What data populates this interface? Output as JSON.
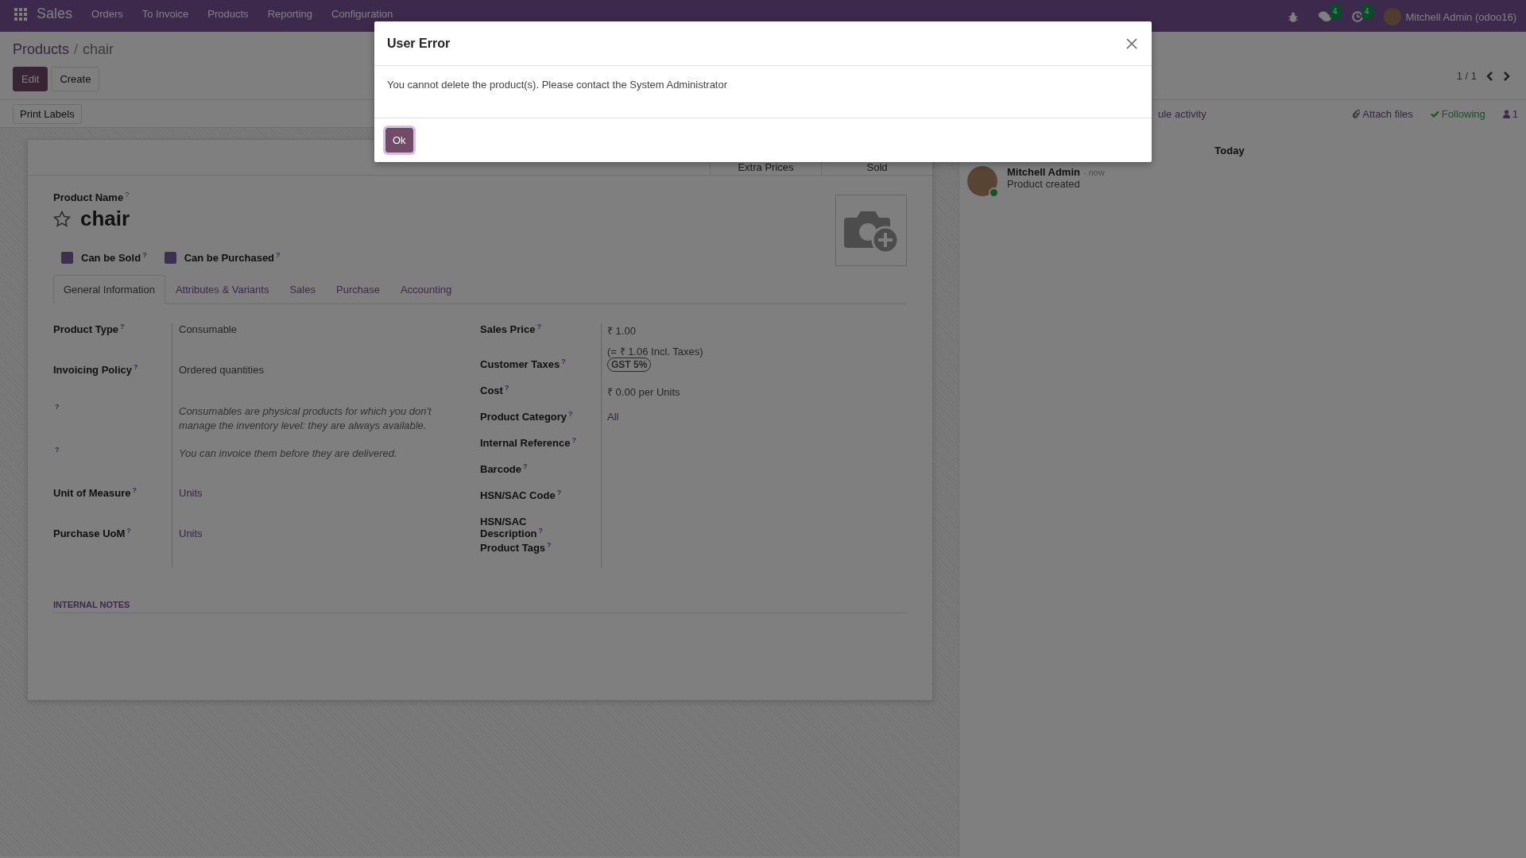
{
  "navbar": {
    "app": "Sales",
    "menu": [
      "Orders",
      "To Invoice",
      "Products",
      "Reporting",
      "Configuration"
    ],
    "messages_badge": "4",
    "activities_badge": "4",
    "user": "Mitchell Admin (odoo16)"
  },
  "breadcrumb": {
    "parent": "Products",
    "separator": "/",
    "current": "chair"
  },
  "buttons": [
    {
      "label": "Edit",
      "kind": "primary"
    },
    {
      "label": "Create",
      "kind": "secondary"
    }
  ],
  "pager": "1 / 1",
  "status_actions": [
    "Print Labels"
  ],
  "smart_buttons": [
    "Extra Prices",
    "Sold"
  ],
  "product": {
    "name_label": "Product Name",
    "name_help": "?",
    "name": "chair",
    "favorite": false,
    "options": [
      {
        "label": "Can be Sold",
        "help": "?",
        "checked": true
      },
      {
        "label": "Can be Purchased",
        "help": "?",
        "checked": true
      }
    ]
  },
  "tabs": [
    {
      "label": "General Information",
      "selected": true
    },
    {
      "label": "Attributes & Variants",
      "selected": false
    },
    {
      "label": "Sales",
      "selected": false
    },
    {
      "label": "Purchase",
      "selected": false
    },
    {
      "label": "Accounting",
      "selected": false
    }
  ],
  "fields_left": [
    {
      "label": "Product Type",
      "help": "?",
      "value": "Consumable",
      "kind": "text"
    },
    {
      "label": "Invoicing Policy",
      "help": "?",
      "value": "Ordered quantities",
      "kind": "text"
    },
    {
      "help": "?",
      "value": "Consumables are physical products for which you don't manage the inventory level: they are always available.",
      "kind": "note"
    },
    {
      "help": "?",
      "value": "You can invoice them before they are delivered.",
      "kind": "note"
    },
    {
      "label": "Unit of Measure",
      "help": "?",
      "value": "Units",
      "kind": "link"
    },
    {
      "label": "Purchase UoM",
      "help": "?",
      "value": "Units",
      "kind": "link"
    }
  ],
  "fields_right": [
    {
      "label": "Sales Price",
      "help": "?",
      "value": "₹ 1.00",
      "extra": "(= ₹ 1.06 Incl. Taxes)",
      "kind": "text"
    },
    {
      "label": "Customer Taxes",
      "help": "?",
      "value": "GST 5%",
      "kind": "tag"
    },
    {
      "label": "Cost",
      "help": "?",
      "value": "₹ 0.00",
      "extra": "per Units",
      "kind": "text"
    },
    {
      "label": "Product Category",
      "help": "?",
      "value": "All",
      "kind": "link"
    },
    {
      "label": "Internal Reference",
      "help": "?",
      "kind": "empty"
    },
    {
      "label": "Barcode",
      "help": "?",
      "kind": "empty"
    },
    {
      "label": "HSN/SAC Code",
      "help": "?",
      "kind": "empty"
    },
    {
      "label": "HSN/SAC Description",
      "help": "?",
      "kind": "empty"
    },
    {
      "label": "Product Tags",
      "help": "?",
      "kind": "empty"
    }
  ],
  "internal_notes_title": "INTERNAL NOTES",
  "chatter": {
    "actions": [
      {
        "label": "ule activity",
        "kind": "link"
      },
      {
        "label": "Attach files",
        "kind": "attach"
      },
      {
        "label": "Following",
        "kind": "following"
      },
      {
        "label": "1",
        "kind": "followers"
      }
    ],
    "date_separator": "Today",
    "messages": [
      {
        "author": "Mitchell Admin",
        "time": "- now",
        "body": "Product created",
        "online": true
      }
    ]
  },
  "dialog": {
    "title": "User Error",
    "message": "You cannot delete the product(s). Please contact the System Administrator",
    "buttons": [
      "Ok"
    ]
  }
}
